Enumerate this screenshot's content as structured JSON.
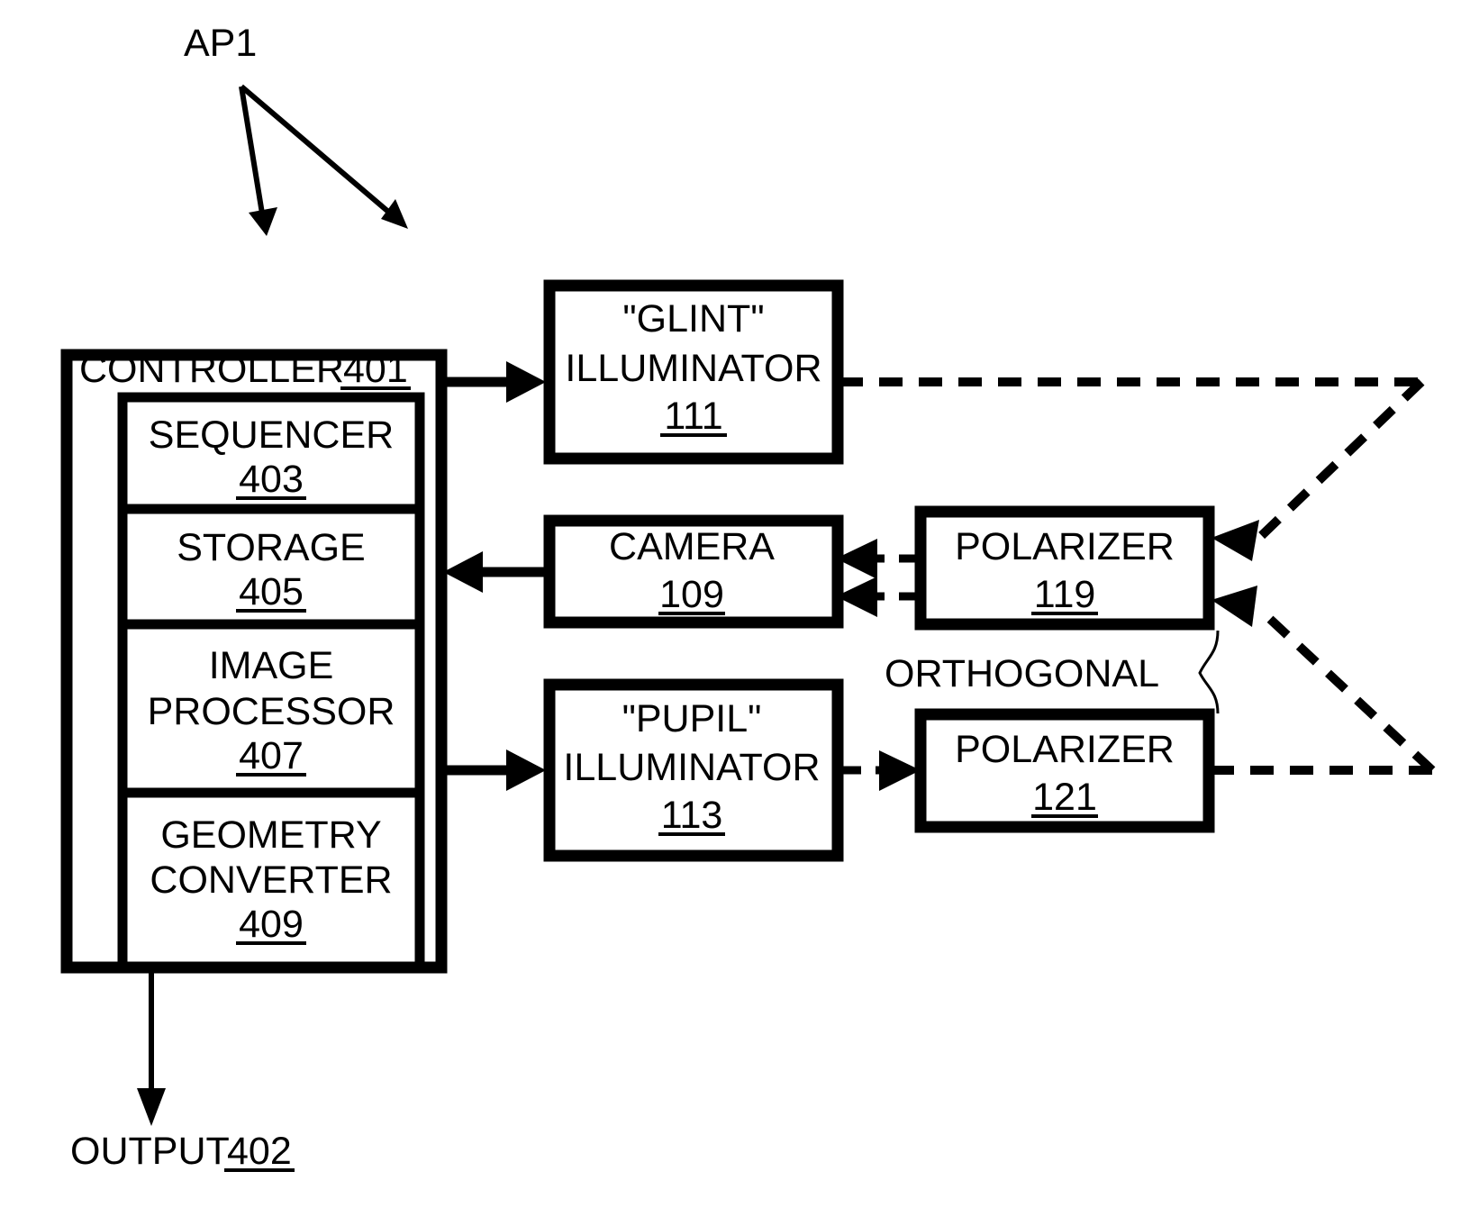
{
  "figure": {
    "callout_label": "AP1",
    "output_label": "OUTPUT",
    "output_ref": "402",
    "orthogonal_label": "ORTHOGONAL"
  },
  "controller": {
    "title": "CONTROLLER",
    "ref": "401",
    "modules": [
      {
        "name": "SEQUENCER",
        "ref": "403",
        "lines": [
          "SEQUENCER"
        ]
      },
      {
        "name": "STORAGE",
        "ref": "405",
        "lines": [
          "STORAGE"
        ]
      },
      {
        "name": "IMAGE PROCESSOR",
        "ref": "407",
        "lines": [
          "IMAGE",
          "PROCESSOR"
        ]
      },
      {
        "name": "GEOMETRY CONVERTER",
        "ref": "409",
        "lines": [
          "GEOMETRY",
          "CONVERTER"
        ]
      }
    ]
  },
  "blocks": {
    "glint_illuminator": {
      "line1": "\"GLINT\"",
      "line2": "ILLUMINATOR",
      "ref": "111"
    },
    "camera": {
      "line1": "CAMERA",
      "ref": "109"
    },
    "pupil_illuminator": {
      "line1": "\"PUPIL\"",
      "line2": "ILLUMINATOR",
      "ref": "113"
    },
    "polarizer_upper": {
      "line1": "POLARIZER",
      "ref": "119"
    },
    "polarizer_lower": {
      "line1": "POLARIZER",
      "ref": "121"
    }
  },
  "colors": {
    "stroke": "#000000",
    "background": "#ffffff"
  }
}
